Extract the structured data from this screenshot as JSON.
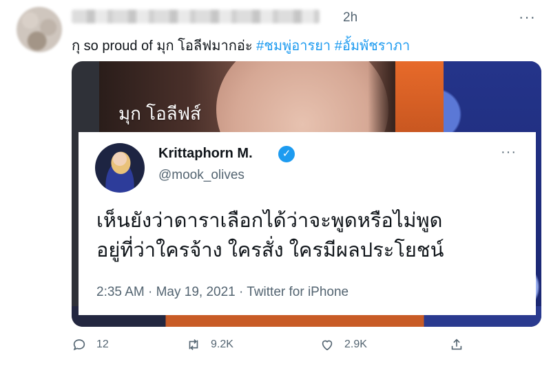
{
  "tweet": {
    "time": "2h",
    "text_plain": "กุ so proud of มุก โอลีฟมากอ่ะ",
    "hashtags": [
      "#ชมพู่อารยา",
      "#อั้มพัชราภา"
    ]
  },
  "media": {
    "caption": "มุก โอลีฟส์",
    "quoted": {
      "name": "Krittaphorn M.",
      "handle": "@mook_olives",
      "body_line1": "เห็นยังว่าดาราเลือกได้ว่าจะพูดหรือไม่พูด",
      "body_line2": "อยู่ที่ว่าใครจ้าง ใครสั่ง ใครมีผลประโยชน์",
      "meta": "2:35 AM · May 19, 2021 · Twitter for iPhone"
    }
  },
  "actions": {
    "reply_count": "12",
    "retweet_count": "9.2K",
    "like_count": "2.9K"
  },
  "icons": [
    "more-icon",
    "verified-icon",
    "reply-icon",
    "retweet-icon",
    "like-icon",
    "share-icon"
  ],
  "colors": {
    "link": "#1d9bf0",
    "muted": "#536471"
  }
}
